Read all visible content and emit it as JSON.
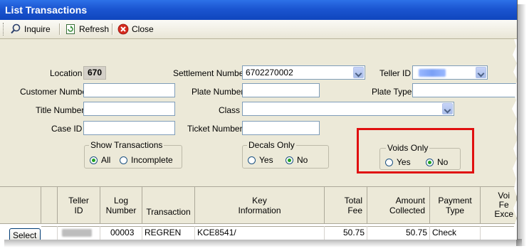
{
  "window": {
    "title": "List Transactions"
  },
  "toolbar": {
    "inquire": "Inquire",
    "refresh": "Refresh",
    "close": "Close"
  },
  "form": {
    "location_label": "Location",
    "location_value": "670",
    "settlement_label": "Settlement Number",
    "settlement_value": "6702270002",
    "teller_label": "Teller ID",
    "customer_label": "Customer Number",
    "plate_number_label": "Plate Number",
    "plate_type_label": "Plate Type",
    "title_number_label": "Title Number",
    "class_label": "Class",
    "case_id_label": "Case ID",
    "ticket_label": "Ticket Number"
  },
  "show_transactions": {
    "legend": "Show Transactions",
    "all": "All",
    "incomplete": "Incomplete",
    "selected": "All"
  },
  "decals_only": {
    "legend": "Decals Only",
    "yes": "Yes",
    "no": "No",
    "selected": "No"
  },
  "voids_only": {
    "legend": "Voids Only",
    "yes": "Yes",
    "no": "No",
    "selected": "No"
  },
  "grid": {
    "columns": {
      "teller_id": [
        "Teller",
        "ID"
      ],
      "log_number": [
        "Log",
        "Number"
      ],
      "transaction": "Transaction",
      "key_info": [
        "Key",
        "Information"
      ],
      "total_fee": [
        "Total",
        "Fee"
      ],
      "amount_collected": [
        "Amount",
        "Collected"
      ],
      "payment_type": [
        "Payment",
        "Type"
      ],
      "void_fee": [
        "Voi",
        "Fe",
        "Exce"
      ]
    },
    "rows": [
      {
        "select": "Select",
        "log_number": "00003",
        "transaction": "REGREN",
        "key_info": "KCE8541/",
        "total_fee": "50.75",
        "amount_collected": "50.75",
        "payment_type": "Check"
      }
    ]
  },
  "colors": {
    "titlebar": "#1b55d1",
    "highlight": "#e01010",
    "window_bg": "#ece9d8"
  }
}
